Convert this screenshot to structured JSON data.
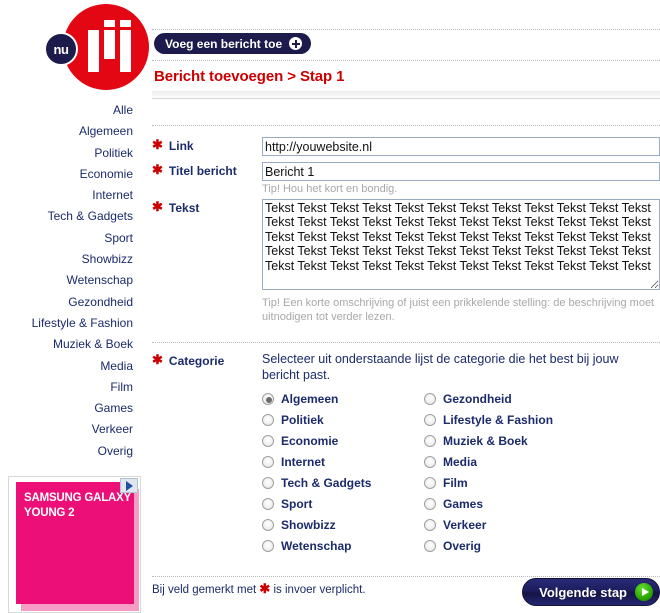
{
  "logo": {
    "badge_text": "nu",
    "circle_color": "#e30613",
    "badge_color": "#1c1b4b"
  },
  "sidebar": {
    "items": [
      {
        "label": "Alle"
      },
      {
        "label": "Algemeen"
      },
      {
        "label": "Politiek"
      },
      {
        "label": "Economie"
      },
      {
        "label": "Internet"
      },
      {
        "label": "Tech & Gadgets"
      },
      {
        "label": "Sport"
      },
      {
        "label": "Showbizz"
      },
      {
        "label": "Wetenschap"
      },
      {
        "label": "Gezondheid"
      },
      {
        "label": "Lifestyle & Fashion"
      },
      {
        "label": "Muziek & Boek"
      },
      {
        "label": "Media"
      },
      {
        "label": "Film"
      },
      {
        "label": "Games"
      },
      {
        "label": "Verkeer"
      },
      {
        "label": "Overig"
      }
    ]
  },
  "ad": {
    "headline": "SAMSUNG GALAXY YOUNG 2",
    "background_color": "#ec0f78",
    "adchoices_icon": "adchoices-triangle-icon"
  },
  "header": {
    "add_button_label": "Voeg een bericht toe",
    "add_button_icon": "plus-circle-icon",
    "page_title": "Bericht toevoegen > Stap 1",
    "title_color": "#cc0000"
  },
  "form": {
    "required_marker": "✱",
    "fields": {
      "link": {
        "label": "Link",
        "value": "http://youwebsite.nl",
        "placeholder": "http://"
      },
      "titel": {
        "label": "Titel bericht",
        "value": "Bericht 1",
        "placeholder": "",
        "tip": "Tip! Hou het kort en bondig."
      },
      "tekst": {
        "label": "Tekst",
        "value": "Tekst Tekst Tekst Tekst Tekst Tekst Tekst Tekst Tekst Tekst Tekst Tekst Tekst Tekst Tekst Tekst Tekst Tekst Tekst Tekst Tekst Tekst Tekst Tekst Tekst Tekst Tekst Tekst Tekst Tekst Tekst Tekst Tekst Tekst Tekst Tekst Tekst Tekst Tekst Tekst Tekst Tekst Tekst Tekst Tekst Tekst Tekst Tekst Tekst Tekst Tekst Tekst Tekst Tekst Tekst Tekst Tekst Tekst Tekst Tekst",
        "placeholder": "",
        "tip": "Tip! Een korte omschrijving of juist een prikkelende stelling: de beschrijving moet uitnodigen tot verder lezen."
      },
      "categorie": {
        "label": "Categorie",
        "intro": "Selecteer uit onderstaande lijst de categorie die het best bij jouw bericht past.",
        "selected": "Algemeen",
        "column_left": [
          {
            "label": "Algemeen",
            "checked": true
          },
          {
            "label": "Politiek",
            "checked": false
          },
          {
            "label": "Economie",
            "checked": false
          },
          {
            "label": "Internet",
            "checked": false
          },
          {
            "label": "Tech & Gadgets",
            "checked": false
          },
          {
            "label": "Sport",
            "checked": false
          },
          {
            "label": "Showbizz",
            "checked": false
          },
          {
            "label": "Wetenschap",
            "checked": false
          }
        ],
        "column_right": [
          {
            "label": "Gezondheid",
            "checked": false
          },
          {
            "label": "Lifestyle & Fashion",
            "checked": false
          },
          {
            "label": "Muziek & Boek",
            "checked": false
          },
          {
            "label": "Media",
            "checked": false
          },
          {
            "label": "Film",
            "checked": false
          },
          {
            "label": "Games",
            "checked": false
          },
          {
            "label": "Verkeer",
            "checked": false
          },
          {
            "label": "Overig",
            "checked": false
          }
        ]
      }
    }
  },
  "footer": {
    "note_before": "Bij veld gemerkt met",
    "note_after": "is invoer verplicht.",
    "next_button_label": "Volgende stap",
    "next_button_icon": "arrow-right-circle-icon"
  }
}
